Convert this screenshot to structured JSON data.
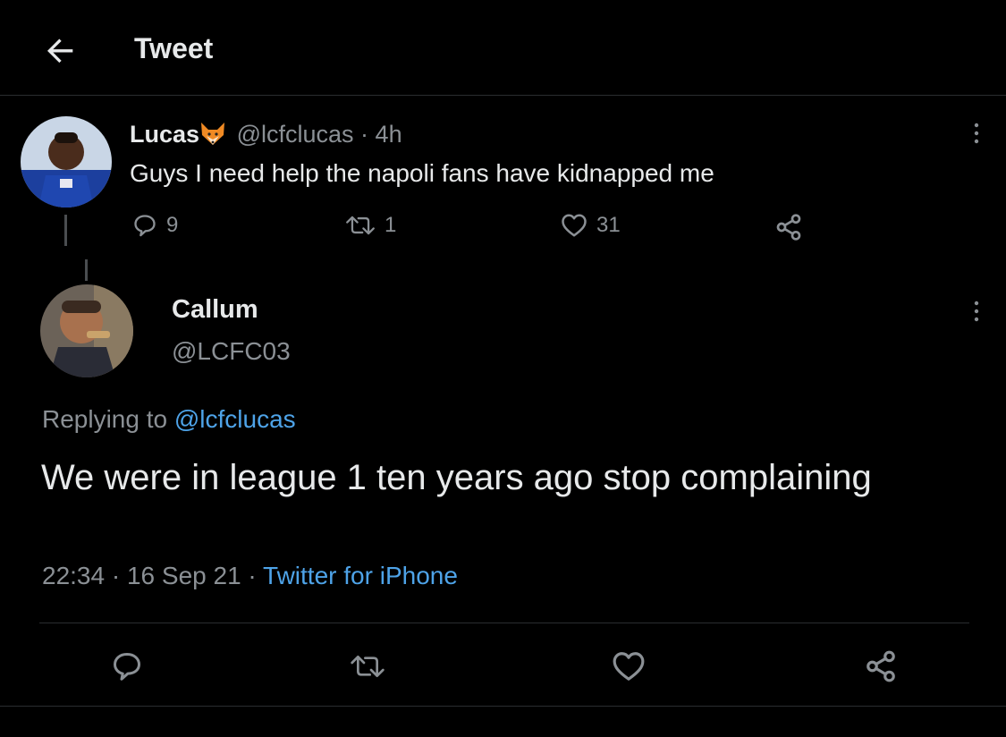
{
  "header": {
    "title": "Tweet",
    "back_icon": "arrow-left-icon"
  },
  "tweet": {
    "author_name": "Lucas",
    "author_emoji": "fox-face-emoji",
    "handle": "@lcfclucas",
    "separator": "·",
    "age": "4h",
    "text": "Guys I need help the napoli fans have kidnapped me",
    "replies": "9",
    "retweets": "1",
    "likes": "31"
  },
  "reply": {
    "author_name": "Callum",
    "handle": "@LCFC03",
    "replying_prefix": "Replying to",
    "replying_to": "@lcfclucas",
    "text": "We were in league 1 ten years ago stop complaining",
    "time": "22:34",
    "date": "16 Sep 21",
    "separator": "·",
    "source": "Twitter for iPhone"
  },
  "colors": {
    "background": "#000000",
    "text": "#e7e9ea",
    "secondary": "#8b9095",
    "link": "#4ea3e8",
    "divider": "#2a2d30"
  }
}
